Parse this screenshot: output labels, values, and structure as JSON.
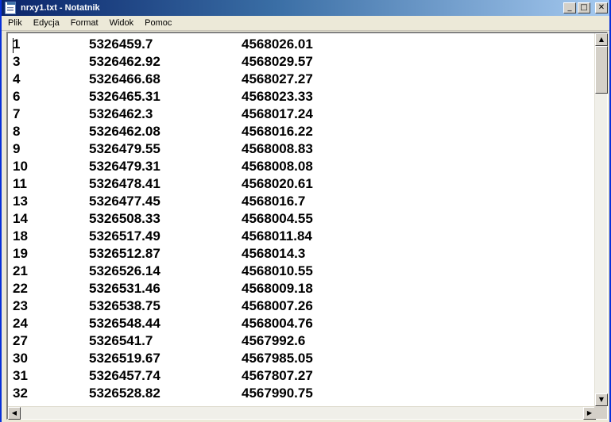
{
  "window": {
    "title": "nrxy1.txt - Notatnik",
    "minimize_icon": "minimize-icon",
    "maximize_icon": "maximize-icon",
    "close_icon": "close-icon"
  },
  "menu": [
    "Plik",
    "Edycja",
    "Format",
    "Widok",
    "Pomoc"
  ],
  "rows": [
    [
      "1",
      "5326459.7",
      "4568026.01"
    ],
    [
      "3",
      "5326462.92",
      "4568029.57"
    ],
    [
      "4",
      "5326466.68",
      "4568027.27"
    ],
    [
      "6",
      "5326465.31",
      "4568023.33"
    ],
    [
      "7",
      "5326462.3",
      "4568017.24"
    ],
    [
      "8",
      "5326462.08",
      "4568016.22"
    ],
    [
      "9",
      "5326479.55",
      "4568008.83"
    ],
    [
      "10",
      "5326479.31",
      "4568008.08"
    ],
    [
      "11",
      "5326478.41",
      "4568020.61"
    ],
    [
      "13",
      "5326477.45",
      "4568016.7"
    ],
    [
      "14",
      "5326508.33",
      "4568004.55"
    ],
    [
      "18",
      "5326517.49",
      "4568011.84"
    ],
    [
      "19",
      "5326512.87",
      "4568014.3"
    ],
    [
      "21",
      "5326526.14",
      "4568010.55"
    ],
    [
      "22",
      "5326531.46",
      "4568009.18"
    ],
    [
      "23",
      "5326538.75",
      "4568007.26"
    ],
    [
      "24",
      "5326548.44",
      "4568004.76"
    ],
    [
      "27",
      "5326541.7",
      "4567992.6"
    ],
    [
      "30",
      "5326519.67",
      "4567985.05"
    ],
    [
      "31",
      "5326457.74",
      "4567807.27"
    ],
    [
      "32",
      "5326528.82",
      "4567990.75"
    ]
  ]
}
